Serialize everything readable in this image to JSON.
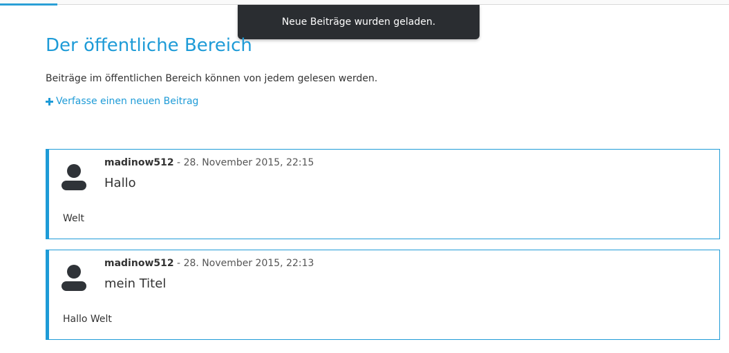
{
  "toast": {
    "message": "Neue Beiträge wurden geladen."
  },
  "page": {
    "title": "Der öffentliche Bereich",
    "description": "Beiträge im öffentlichen Bereich können von jedem gelesen werden.",
    "new_post_link": "Verfasse einen neuen Beitrag"
  },
  "posts": [
    {
      "author": "madinow512",
      "separator": " - ",
      "date": "28. November 2015, 22:15",
      "title": "Hallo",
      "body": "Welt"
    },
    {
      "author": "madinow512",
      "separator": " - ",
      "date": "28. November 2015, 22:13",
      "title": "mein Titel",
      "body": "Hallo Welt"
    }
  ],
  "colors": {
    "accent": "#1e9bd7",
    "toast_bg": "#2a2d31",
    "avatar": "#2f3338"
  },
  "icons": {
    "plus": "plus-icon",
    "avatar": "user-avatar-icon"
  }
}
